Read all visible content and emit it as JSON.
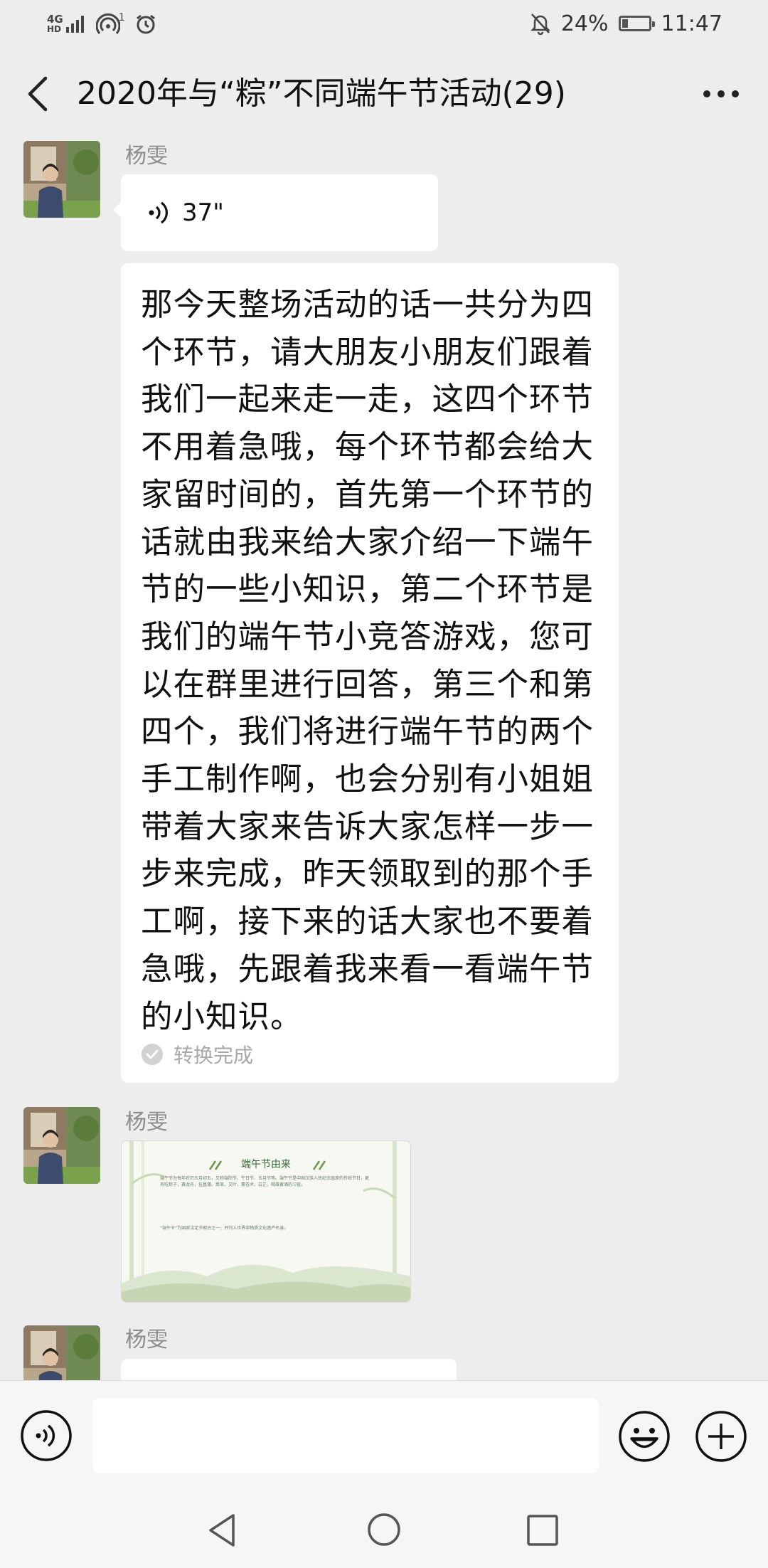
{
  "status_bar": {
    "network_top": "4G",
    "network_bottom": "HD",
    "wifi_superscript": "1",
    "battery": "24%",
    "battery_level": 0.24,
    "time": "11:47",
    "icons": [
      "signal-icon",
      "hotspot-icon",
      "alarm-icon",
      "mute-icon",
      "battery-icon"
    ]
  },
  "header": {
    "title": "2020年与“粽”不同端午节活动(29)",
    "back_icon": "chevron-left-icon",
    "menu_icon": "more-icon"
  },
  "messages": [
    {
      "type": "voice",
      "sender": "杨雯",
      "duration": "37\"",
      "transcript": "那今天整场活动的话一共分为四个环节，请大朋友小朋友们跟着我们一起来走一走，这四个环节不用着急哦，每个环节都会给大家留时间的，首先第一个环节的话就由我来给大家介绍一下端午节的一些小知识，第二个环节是我们的端午节小竞答游戏，您可以在群里进行回答，第三个和第四个，我们将进行端午节的两个手工制作啊，也会分别有小姐姐带着大家来告诉大家怎样一步一步来完成，昨天领取到的那个手工啊，接下来的话大家也不要着急哦，先跟着我来看一看端午节的小知识。",
      "transcript_status": "转换完成"
    },
    {
      "type": "image",
      "sender": "杨雯",
      "image_title": "端午节由来",
      "image_text": [
        "端午节为每年农历五月初五，又称端阳节、午日节、五月节等。端午节是中国汉族人民纪念屈原的传统节日，更有吃粽子，赛龙舟，挂菖蒲、蒿草、艾叶，薰苍术、白芷，喝雄黄酒的习俗。",
        "“端午节”为国家法定节假日之一，并列入世界非物质文化遗产名录。"
      ]
    },
    {
      "type": "text",
      "sender": "杨雯"
    }
  ],
  "input_bar": {
    "placeholder": "",
    "value": ""
  },
  "nav_bar": {
    "icons": [
      "nav-back-icon",
      "nav-home-icon",
      "nav-recent-icon"
    ]
  }
}
